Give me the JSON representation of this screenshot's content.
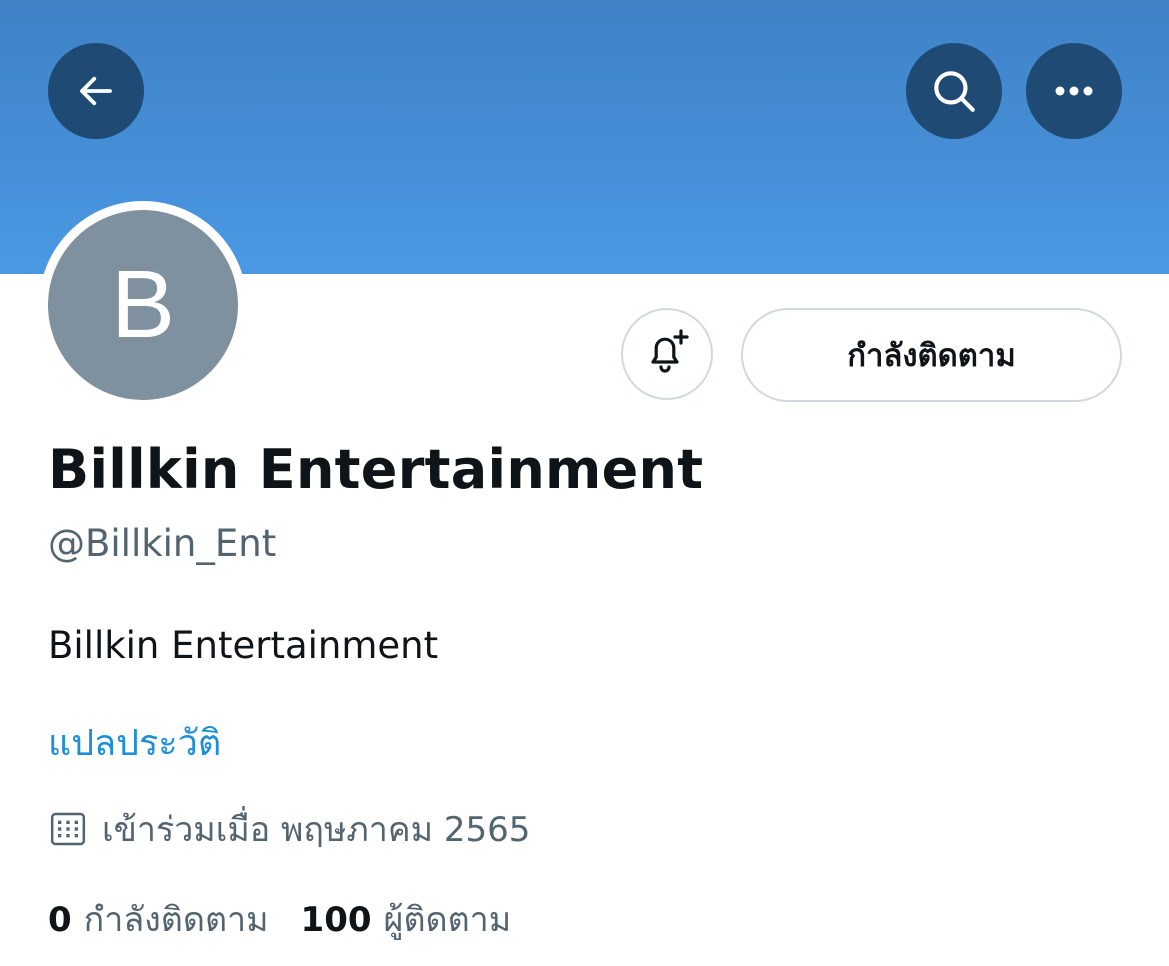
{
  "header": {
    "back_icon": "arrow-left-icon",
    "search_icon": "search-icon",
    "more_icon": "more-horizontal-icon",
    "banner_color": "#4a98e4",
    "button_color": "#1f4a73"
  },
  "profile": {
    "avatar_letter": "B",
    "avatar_color": "#7f909e",
    "display_name": "Billkin Entertainment",
    "handle": "@Billkin_Ent",
    "bio": "Billkin Entertainment",
    "translate_bio": "แปลประวัติ",
    "joined": "เข้าร่วมเมื่อ พฤษภาคม 2565"
  },
  "actions": {
    "notify_icon": "bell-plus-icon",
    "following_label": "กำลังติดตาม"
  },
  "stats": {
    "following_count": "0",
    "following_label": "กำลังติดตาม",
    "followers_count": "100",
    "followers_label": "ผู้ติดตาม"
  }
}
